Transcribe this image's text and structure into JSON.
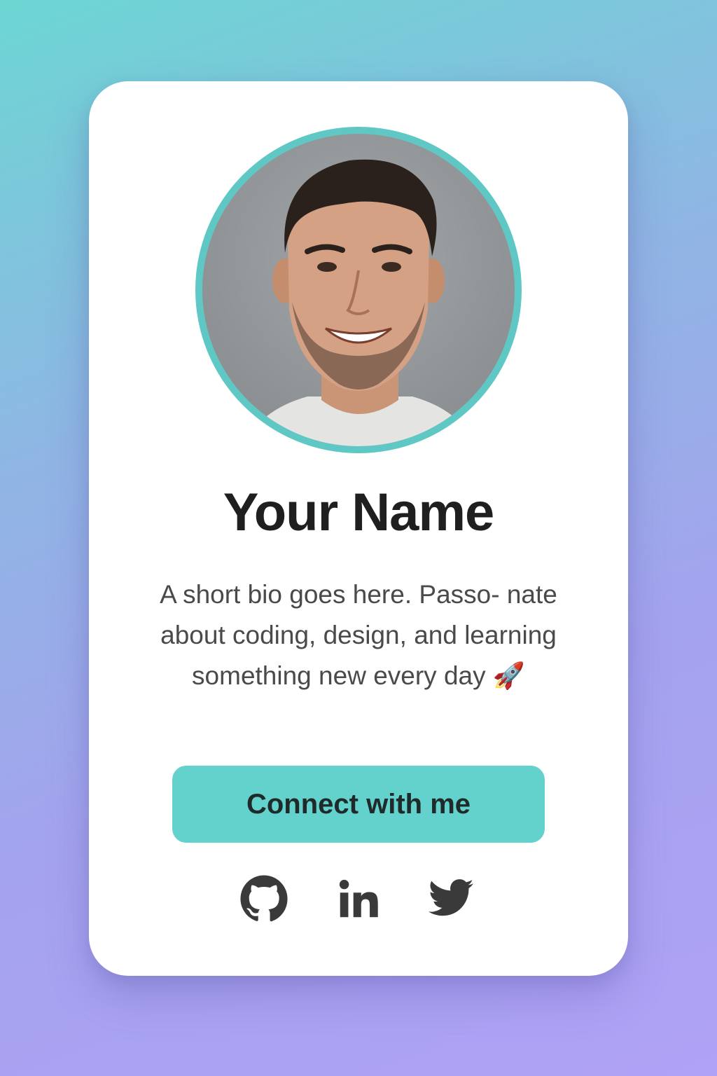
{
  "profile": {
    "name": "Your Name",
    "bio": "A short bio goes here. Passo- nate about coding, design, and learning something new every day 🚀",
    "avatar_alt": "Profile photo"
  },
  "actions": {
    "connect_label": "Connect with me"
  },
  "socials": [
    {
      "name": "GitHub",
      "icon": "github-icon"
    },
    {
      "name": "LinkedIn",
      "icon": "linkedin-icon"
    },
    {
      "name": "Twitter",
      "icon": "twitter-icon"
    }
  ],
  "colors": {
    "accent": "#64d2cc",
    "ring": "#5fc8c4",
    "text_dark": "#1f1f1f",
    "text_muted": "#4a4a4a",
    "icon": "#3a3a3a",
    "bg_start": "#6cd6d3",
    "bg_end": "#b0a2f6"
  }
}
